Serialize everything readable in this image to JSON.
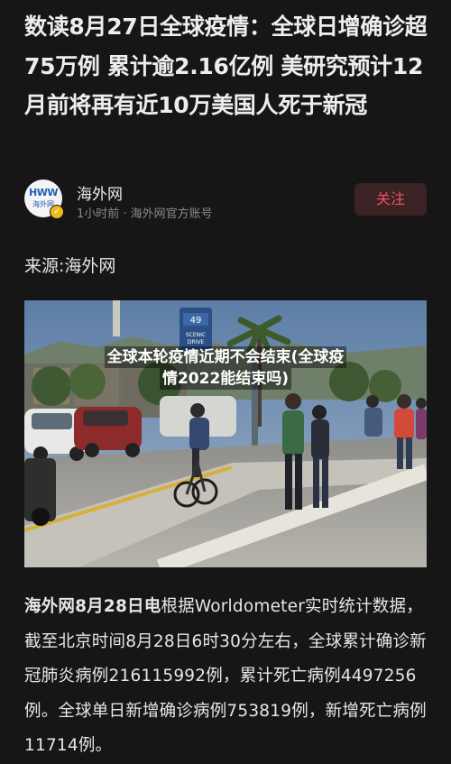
{
  "article": {
    "title": "数读8月27日全球疫情：全球日增确诊超75万例 累计逾2.16亿例 美研究预计12月前将再有近10万美国人死于新冠",
    "author": {
      "name": "海外网",
      "avatar_text": "HWW",
      "avatar_subtext": "海外网",
      "meta": "1小时前 · 海外网官方账号",
      "follow_label": "关注"
    },
    "source_label": "来源:海外网",
    "image": {
      "caption_line1": "全球本轮疫情近期不会结束(全球疫",
      "caption_line2": "情2022能结束吗)",
      "sign_text_1": "SCENIC",
      "sign_text_2": "DRIVE",
      "sign_number": "49"
    },
    "body": {
      "dateline": "海外网8月28日电",
      "text": "根据Worldometer实时统计数据，截至北京时间8月28日6时30分左右，全球累计确诊新冠肺炎病例216115992例，累计死亡病例4497256例。全球单日新增确诊病例753819例，新增死亡病例11714例。"
    }
  },
  "colors": {
    "background": "#161616",
    "follow_text": "#f0535c",
    "follow_bg": "#3b2224",
    "meta_gray": "#8a8a8a"
  }
}
